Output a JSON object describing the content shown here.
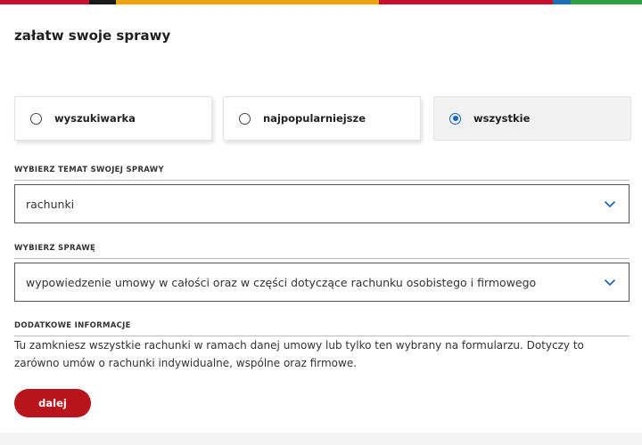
{
  "page": {
    "title": "załatw swoje sprawy",
    "top_bar_colors": [
      "#c8102e",
      "#1a1a1a",
      "#f0a30a",
      "#c8102e",
      "#1f6fb5",
      "#2e9e47"
    ]
  },
  "modes": [
    {
      "label": "wyszukiwarka",
      "selected": false
    },
    {
      "label": "najpopularniejsze",
      "selected": false
    },
    {
      "label": "wszystkie",
      "selected": true
    }
  ],
  "topic": {
    "section_label": "WYBIERZ TEMAT SWOJEJ SPRAWY",
    "value": "rachunki"
  },
  "case": {
    "section_label": "WYBIERZ SPRAWĘ",
    "value": "wypowiedzenie umowy w całości oraz w części dotyczące rachunku osobistego i firmowego"
  },
  "info": {
    "section_label": "DODATKOWE INFORMACJE",
    "text": "Tu zamkniesz wszystkie rachunki w ramach danej umowy lub tylko ten wybrany na formularzu. Dotyczy to zarówno umów o rachunki indywidualne, wspólne oraz firmowe."
  },
  "actions": {
    "next_label": "dalej"
  },
  "colors": {
    "accent": "#b7141b",
    "radio_selected": "#1565c0",
    "chevron": "#1f5fa8"
  }
}
